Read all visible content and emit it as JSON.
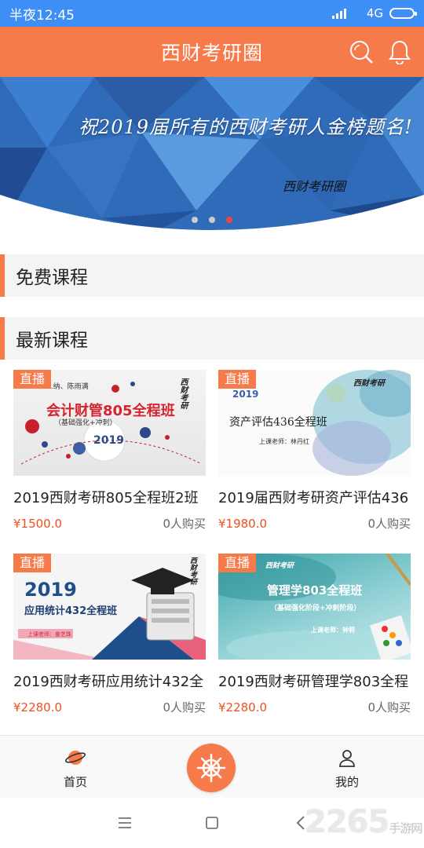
{
  "status_bar": {
    "time": "半夜12:45",
    "network": "4G"
  },
  "header": {
    "title": "西财考研圈",
    "icons": [
      "search-icon",
      "bell-icon"
    ]
  },
  "banner": {
    "headline": "祝2019届所有的西财考研人金榜题名!",
    "signature": "西财考研圈",
    "slide_count": 3,
    "active_slide": 3
  },
  "sections": {
    "free": "免费课程",
    "latest": "最新课程"
  },
  "courses": [
    {
      "badge": "直播",
      "title": "2019西财考研805全程班2班",
      "price": "¥1500.0",
      "buyers": "0人购买",
      "thumb": {
        "heading": "会计财管805全程班",
        "sub": "（基础强化+冲刺）",
        "year": "2019",
        "teachers": "...纳、陈雨满",
        "brand": "西财考研"
      }
    },
    {
      "badge": "直播",
      "title": "2019届西财考研资产评估436",
      "price": "¥1980.0",
      "buyers": "0人购买",
      "thumb": {
        "heading": "资产评估436全程班",
        "year": "2019",
        "teacher": "上课老师：林丹红",
        "brand": "西财考研"
      }
    },
    {
      "badge": "直播",
      "title": "2019西财考研应用统计432全",
      "price": "¥2280.0",
      "buyers": "0人购买",
      "thumb": {
        "heading": "应用统计432全程班",
        "year": "2019",
        "teacher": "上课老师：姜艺珠",
        "brand": "西财考研"
      }
    },
    {
      "badge": "直播",
      "title": "2019西财考研管理学803全程",
      "price": "¥2280.0",
      "buyers": "0人购买",
      "thumb": {
        "heading": "管理学803全程班",
        "sub": "（基础强化阶段+冲刺阶段）",
        "teacher": "上课老师：钟莉",
        "brand": "西财考研"
      }
    }
  ],
  "bottom_nav": {
    "home": "首页",
    "mine": "我的",
    "center_icon": "helm-icon"
  },
  "watermark": {
    "text": "2265",
    "suffix": "手游网"
  },
  "colors": {
    "accent": "#f77a4b",
    "status_bar": "#3d8ef5",
    "price": "#f0501f"
  }
}
